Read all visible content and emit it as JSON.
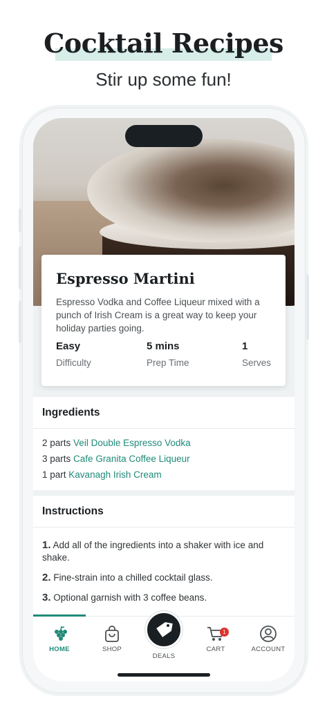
{
  "promo": {
    "title": "Cocktail Recipes",
    "subtitle": "Stir up some fun!"
  },
  "recipe": {
    "name": "Espresso Martini",
    "description": "Espresso Vodka and Coffee Liqueur mixed with a punch of Irish Cream is a great way to keep your holiday parties going.",
    "stats": [
      {
        "value": "Easy",
        "label": "Difficulty"
      },
      {
        "value": "5 mins",
        "label": "Prep Time"
      },
      {
        "value": "1",
        "label": "Serves"
      }
    ]
  },
  "ingredients": {
    "heading": "Ingredients",
    "items": [
      {
        "qty": "2 parts",
        "name": "Veil Double Espresso Vodka"
      },
      {
        "qty": "3 parts",
        "name": "Cafe Granita Coffee Liqueur"
      },
      {
        "qty": "1 part",
        "name": "Kavanagh Irish Cream"
      }
    ]
  },
  "instructions": {
    "heading": "Instructions",
    "steps": [
      {
        "num": "1.",
        "text": "Add all of the ingredients into a shaker with ice and shake."
      },
      {
        "num": "2.",
        "text": "Fine-strain into a chilled cocktail glass."
      },
      {
        "num": "3.",
        "text": "Optional garnish with 3 coffee beans."
      }
    ]
  },
  "tabbar": {
    "home": "HOME",
    "shop": "SHOP",
    "deals": "DEALS",
    "cart": "CART",
    "cart_badge": "1",
    "account": "ACCOUNT"
  },
  "icons": {
    "home": "grapes-icon",
    "shop": "shopping-bag-icon",
    "deals": "tag-icon",
    "cart": "cart-icon",
    "account": "user-circle-icon"
  },
  "colors": {
    "accent": "#1f8a78",
    "badge": "#e0322e",
    "dark": "#1a1f23"
  }
}
